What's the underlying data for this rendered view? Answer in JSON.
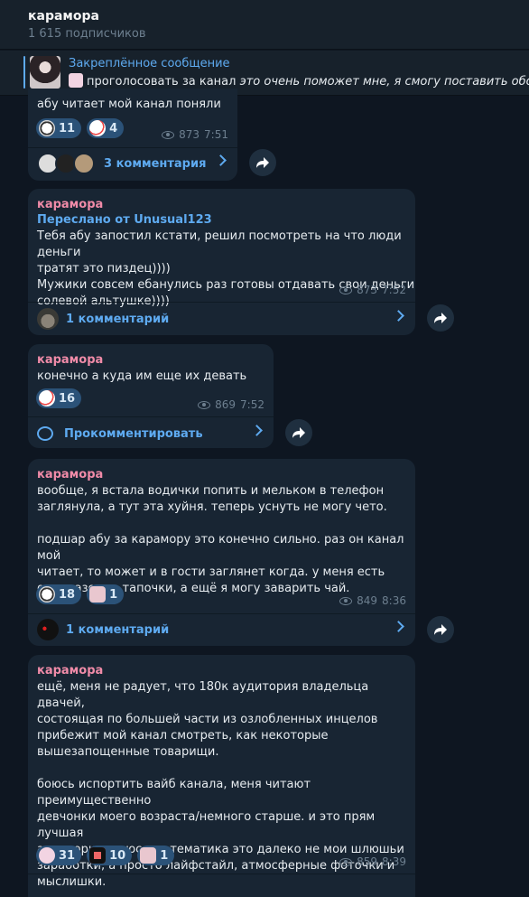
{
  "header": {
    "title": "карамора",
    "subscribers": "1 615 подписчиков"
  },
  "pinned": {
    "title": "Закреплённое сообщение",
    "text_plain": "проголосовать за канал",
    "text_italic": "это очень поможет мне, я смогу поставить обои и сд"
  },
  "messages": [
    {
      "text": "абу читает мой канал поняли",
      "reactions": [
        {
          "count": "11"
        },
        {
          "count": "4"
        }
      ],
      "views": "873",
      "time": "7:51",
      "comments": "3 комментария"
    },
    {
      "sender": "карамора",
      "forwarded": "Переслано от Unusual123",
      "text": "Тебя абу запостил кстати, решил посмотреть на что люди деньги\nтратят это пиздец))))\nМужики совсем ебанулись раз готовы отдавать свои деньги\nсолевой альтушке))))",
      "views": "873",
      "time": "7:52",
      "comments": "1 комментарий"
    },
    {
      "sender": "карамора",
      "text": "конечно а куда им еще их девать",
      "reactions": [
        {
          "count": "16"
        }
      ],
      "views": "869",
      "time": "7:52",
      "comments": "Прокомментировать"
    },
    {
      "sender": "карамора",
      "text": "вообще, я встала водички попить и мельком в телефон\nзаглянула, а тут эта хуйня. теперь уснуть не могу чето.\n\nподшар абу за карамору это конечно сильно. раз он канал мой\nчитает, то может и в гости заглянет когда. у меня есть\nодноразовые тапочки, а ещё я могу заварить чай.",
      "reactions": [
        {
          "count": "18"
        },
        {
          "count": "1"
        }
      ],
      "views": "849",
      "time": "8:36",
      "comments": "1 комментарий"
    },
    {
      "sender": "карамора",
      "text": "ещё, меня не радует, что 180к аудитория владельца двачей,\nсостоящая по большей части из озлобленных инцелов\nприбежит мой канал смотреть, как некоторые\nвышезапощенные товарищи.\n\nбоюсь испортить вайб канала, меня читают преимущественно\nдевчонки моего возраста/немного старше. и это прям лучшая\nаудитория. плюс его тематика это далеко не мои шлюшьи\nзаработки, а просто лайфстайл, атмосферные фоточки и\nмыслишки.",
      "reactions": [
        {
          "count": "31"
        },
        {
          "count": "10"
        },
        {
          "count": "1"
        }
      ],
      "views": "859",
      "time": "8:39"
    }
  ],
  "colors": {
    "accent": "#5eaaf0",
    "sender": "#f08ba8",
    "bubble": "#182533",
    "background": "#0e1621"
  },
  "icons": [
    "eye-icon",
    "share-icon",
    "chevron-right-icon",
    "comment-icon"
  ]
}
